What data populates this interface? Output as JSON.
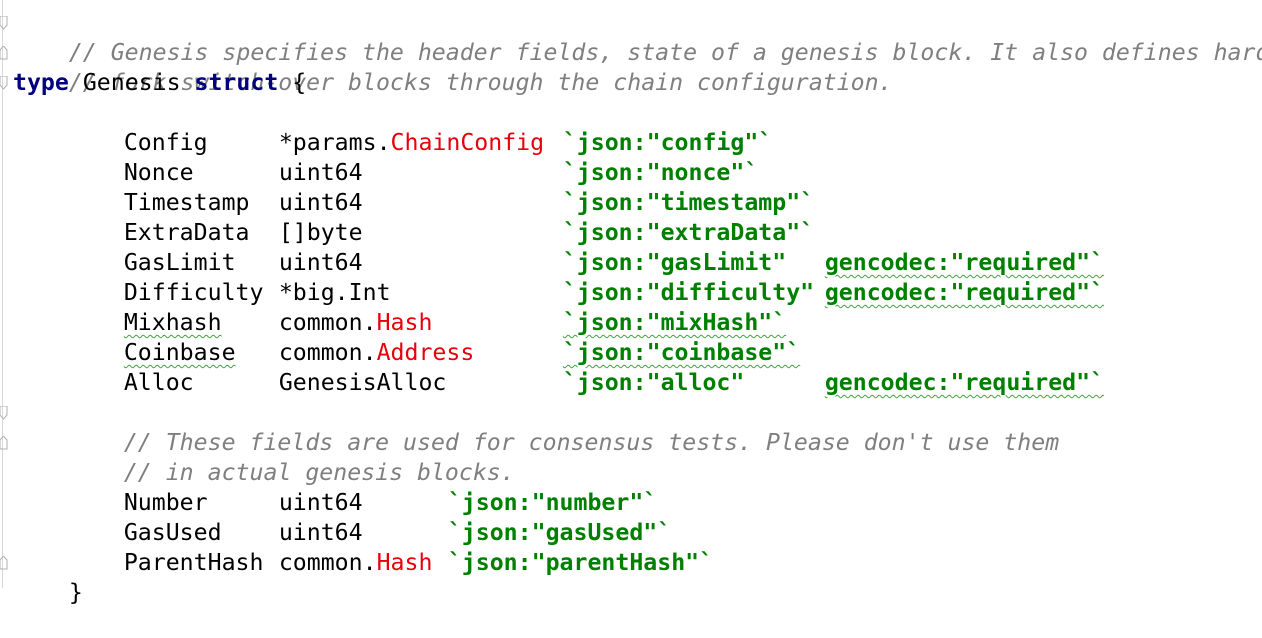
{
  "colors": {
    "comment": "#7f7f7f",
    "keyword": "#000080",
    "type_highlight": "#e6000b",
    "struct_tag": "#008000",
    "text": "#000000",
    "background": "#ffffff"
  },
  "code": {
    "comment1": "// Genesis specifies the header fields, state of a genesis block. It also defines hard",
    "comment2": "// fork switch-over blocks through the chain configuration.",
    "decl": {
      "kw_type": "type",
      "name": "Genesis",
      "kw_struct": "struct",
      "open_brace": "{"
    },
    "fields": [
      {
        "name": "Config",
        "type_prefix": "*params.",
        "type_name": "ChainConfig",
        "tag": "`json:\"config\"`",
        "tag2": ""
      },
      {
        "name": "Nonce",
        "type_prefix": "uint64",
        "type_name": "",
        "tag": "`json:\"nonce\"`",
        "tag2": ""
      },
      {
        "name": "Timestamp",
        "type_prefix": "uint64",
        "type_name": "",
        "tag": "`json:\"timestamp\"`",
        "tag2": ""
      },
      {
        "name": "ExtraData",
        "type_prefix": "[]byte",
        "type_name": "",
        "tag": "`json:\"extraData\"`",
        "tag2": ""
      },
      {
        "name": "GasLimit",
        "type_prefix": "uint64",
        "type_name": "",
        "tag": "`json:\"gasLimit\"",
        "tag2": "gencodec:\"required\"`"
      },
      {
        "name": "Difficulty",
        "type_prefix": "*big.Int",
        "type_name": "",
        "tag": "`json:\"difficulty\"",
        "tag2": "gencodec:\"required\"`"
      },
      {
        "name": "Mixhash",
        "type_prefix": "common.",
        "type_name": "Hash",
        "tag": "`json:\"mixHash\"`",
        "tag2": ""
      },
      {
        "name": "Coinbase",
        "type_prefix": "common.",
        "type_name": "Address",
        "tag": "`json:\"coinbase\"`",
        "tag2": ""
      },
      {
        "name": "Alloc",
        "type_prefix": "GenesisAlloc",
        "type_name": "",
        "tag": "`json:\"alloc\"",
        "tag2": "gencodec:\"required\"`"
      }
    ],
    "comment3": "// These fields are used for consensus tests. Please don't use them",
    "comment4": "// in actual genesis blocks.",
    "fields2": [
      {
        "name": "Number",
        "type_prefix": "uint64",
        "type_name": "",
        "tag": "`json:\"number\"`"
      },
      {
        "name": "GasUsed",
        "type_prefix": "uint64",
        "type_name": "",
        "tag": "`json:\"gasUsed\"`"
      },
      {
        "name": "ParentHash",
        "type_prefix": "common.",
        "type_name": "Hash",
        "tag": "`json:\"parentHash\"`"
      }
    ],
    "close_brace": "}"
  }
}
